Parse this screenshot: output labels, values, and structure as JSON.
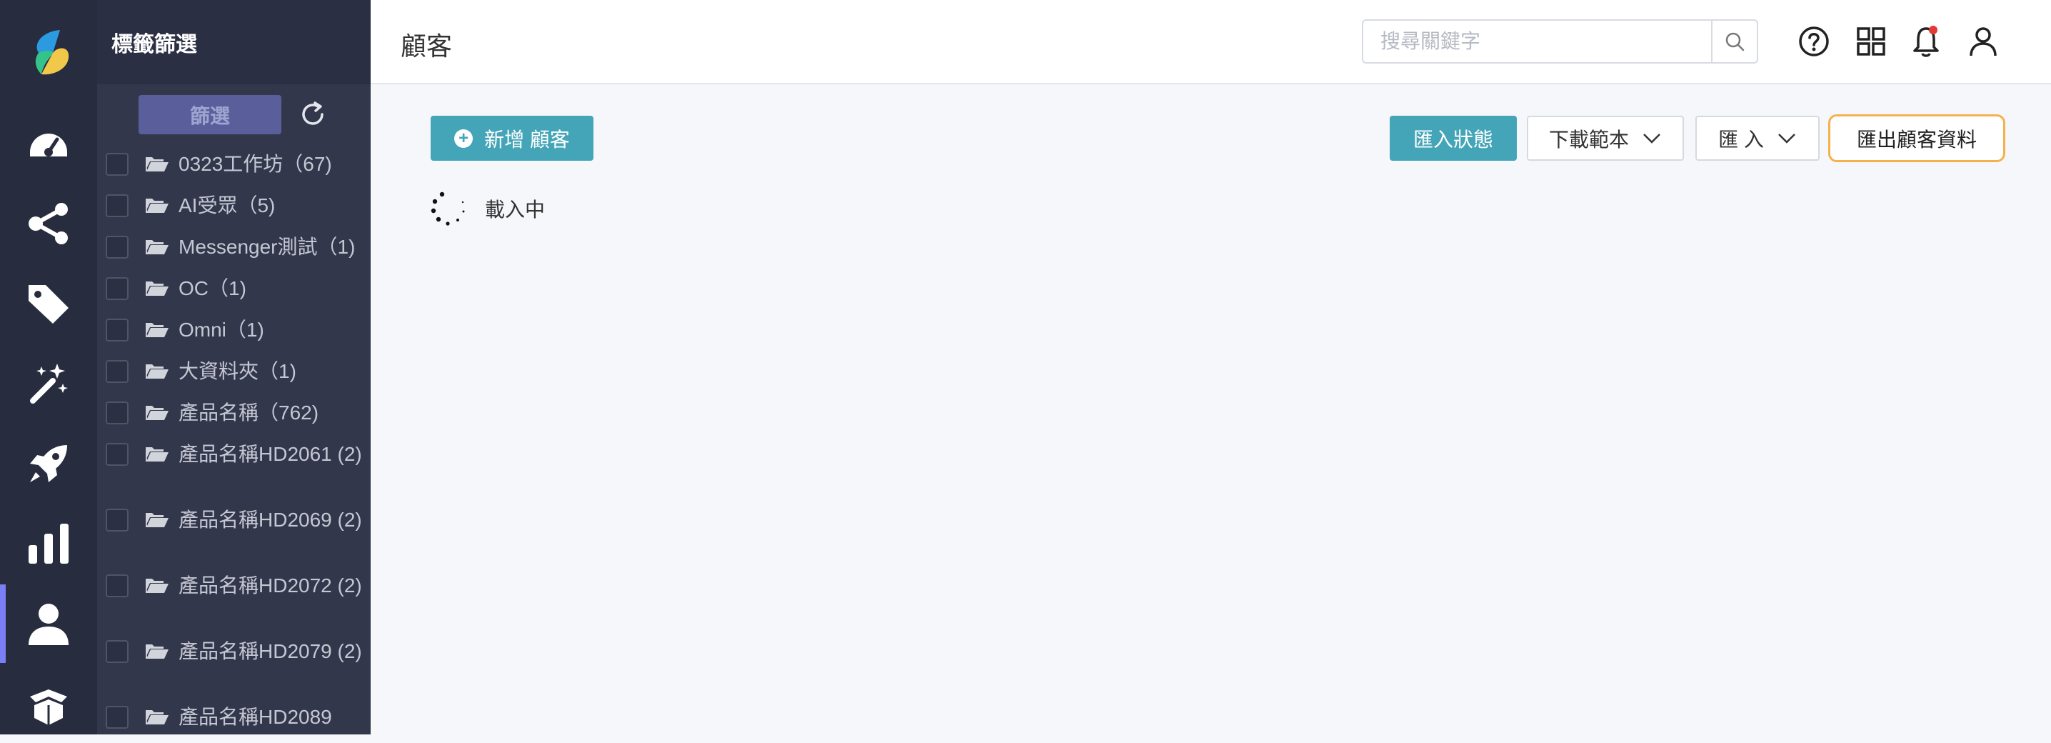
{
  "panel": {
    "title": "標籤篩選",
    "filter_label": "篩選",
    "tags": [
      {
        "label": "0323工作坊（67)"
      },
      {
        "label": "AI受眾（5)"
      },
      {
        "label": "Messenger測試（1)"
      },
      {
        "label": "OC（1)"
      },
      {
        "label": "Omni（1)"
      },
      {
        "label": "大資料夾（1)"
      },
      {
        "label": "產品名稱（762)"
      },
      {
        "label": "產品名稱HD2061 (2)"
      },
      {
        "label": "產品名稱HD2069 (2)"
      },
      {
        "label": "產品名稱HD2072 (2)"
      },
      {
        "label": "產品名稱HD2079 (2)"
      },
      {
        "label": "產品名稱HD2089"
      }
    ]
  },
  "header": {
    "title": "顧客",
    "search_placeholder": "搜尋關鍵字"
  },
  "toolbar": {
    "add_label": "新增 顧客",
    "import_status_label": "匯入狀態",
    "download_template_label": "下載範本",
    "import_label": "匯 入",
    "export_label": "匯出顧客資料"
  },
  "loading_text": "載入中",
  "colors": {
    "accent": "#43a5b7",
    "rail_bg": "#282c3f",
    "panel_bg": "#33374b",
    "active_indicator": "#7b7ff5",
    "export_border": "#f5b14c",
    "notification_dot": "#e53935"
  }
}
